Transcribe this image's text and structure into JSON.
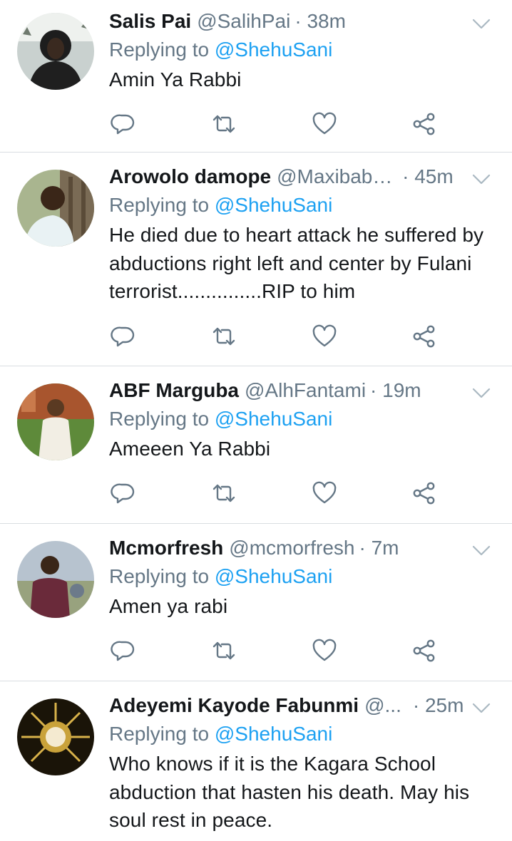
{
  "colors": {
    "link": "#1da1f2",
    "muted": "#657786",
    "text": "#14171a",
    "divider": "#d9dde1"
  },
  "icons": {
    "reply": "reply-icon",
    "retweet": "retweet-icon",
    "like": "heart-icon",
    "share": "share-icon",
    "more": "chevron-down-icon"
  },
  "tweets": [
    {
      "name": "Salis Pai",
      "handle": "@SalihPai",
      "time": "· 38m",
      "replying_prefix": "Replying to ",
      "mention": "@ShehuSani",
      "text": "Amin Ya Rabbi"
    },
    {
      "name": "Arowolo damope",
      "handle": "@Maxibaba...",
      "time": "· 45m",
      "replying_prefix": "Replying to ",
      "mention": "@ShehuSani",
      "text": "He died due to heart attack he suffered by abductions right left and center by Fulani terrorist...............RIP to him"
    },
    {
      "name": "ABF Marguba",
      "handle": "@AlhFantami",
      "time": "· 19m",
      "replying_prefix": "Replying to ",
      "mention": "@ShehuSani",
      "text": "Ameeen Ya Rabbi"
    },
    {
      "name": "Mcmorfresh",
      "handle": "@mcmorfresh",
      "time": "· 7m",
      "replying_prefix": "Replying to ",
      "mention": "@ShehuSani",
      "text": "Amen ya rabi"
    },
    {
      "name": "Adeyemi Kayode Fabunmi",
      "handle": "@...",
      "time": "· 25m",
      "replying_prefix": "Replying to ",
      "mention": "@ShehuSani",
      "text": "Who knows if it is the Kagara School abduction that hasten his death. May his soul rest in peace."
    }
  ]
}
